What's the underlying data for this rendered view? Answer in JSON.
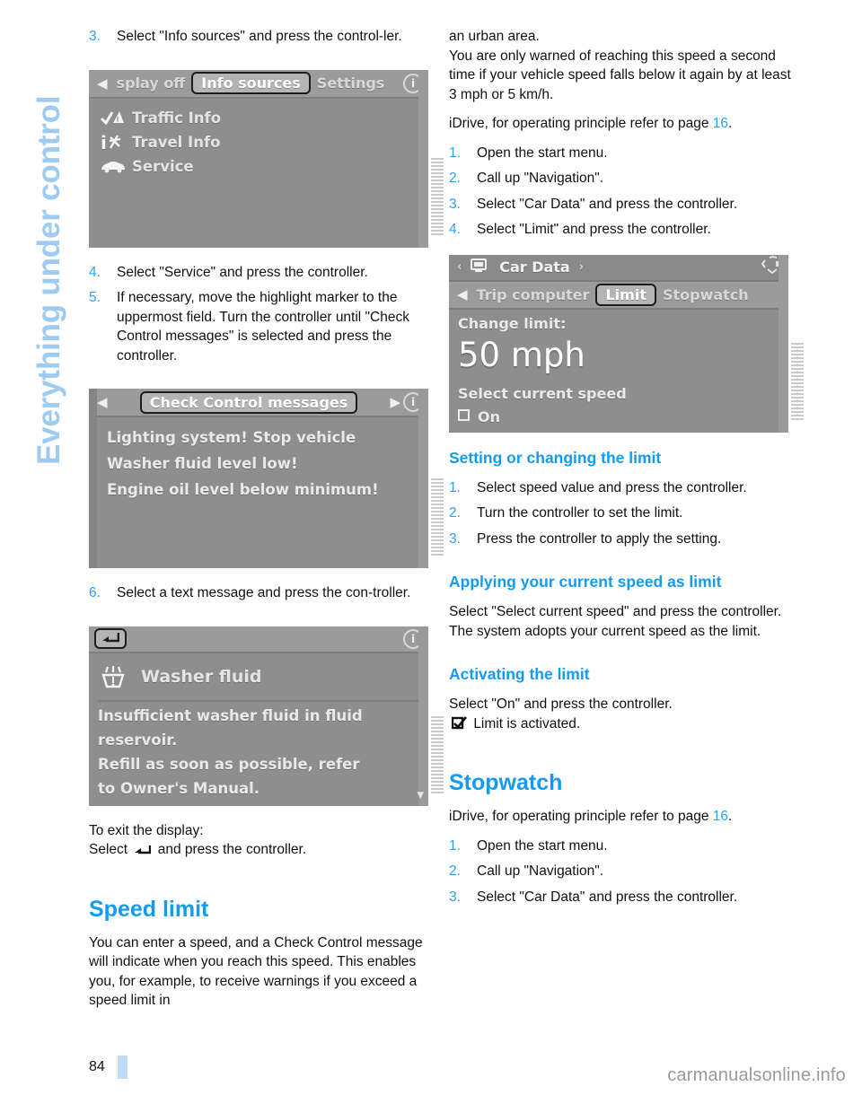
{
  "chapter": {
    "title": "Everything under control"
  },
  "footer": {
    "page_number": "84",
    "watermark": "carmanualsonline.info"
  },
  "left_column": {
    "step3": {
      "num": "3.",
      "text": "Select \"Info sources\" and press the control-ler."
    },
    "shot_info_sources": {
      "tabs": [
        {
          "label": "splay off",
          "selected": false
        },
        {
          "label": "Info sources",
          "selected": true
        },
        {
          "label": "Settings",
          "selected": false
        }
      ],
      "left_arrow": "◀",
      "info_glyph": "i",
      "items": [
        {
          "icon": "traffic-info-icon",
          "label": "Traffic Info"
        },
        {
          "icon": "travel-info-icon",
          "label": "Travel Info"
        },
        {
          "icon": "service-car-icon",
          "label": "Service"
        }
      ]
    },
    "steps_4_5": [
      {
        "num": "4.",
        "text": "Select \"Service\" and press the controller."
      },
      {
        "num": "5.",
        "text": "If necessary, move the highlight marker to the uppermost field. Turn the controller until \"Check Control messages\" is selected and press the controller."
      }
    ],
    "shot_check_control": {
      "title": "Check Control messages",
      "left_arrow": "◀",
      "right_arrow": "▶",
      "info_glyph": "i",
      "messages": [
        "Lighting system! Stop vehicle",
        "Washer fluid level low!",
        "Engine oil level below minimum!"
      ]
    },
    "step6": {
      "num": "6.",
      "text": "Select a text message and press the con-troller."
    },
    "shot_washer_fluid": {
      "back_button": "back-arrow-icon",
      "info_glyph": "i",
      "item_icon": "washer-fluid-icon",
      "item_label": "Washer fluid",
      "body_lines": [
        "Insufficient washer fluid in fluid",
        "reservoir.",
        "Refill as soon as possible, refer",
        "to Owner's Manual."
      ],
      "scroll_caret": "▾"
    },
    "exit_display": {
      "line1": "To exit the display:",
      "line2_before": "Select",
      "line2_after": "and press the controller."
    },
    "speed_limit": {
      "heading": "Speed limit",
      "paragraph": "You can enter a speed, and a Check Control message will indicate when you reach this speed. This enables you, for example, to receive warnings if you exceed a speed limit in"
    }
  },
  "right_column": {
    "continued_paragraph_1": "an urban area.",
    "continued_paragraph_2": "You are only warned of reaching this speed a second time if your vehicle speed falls below it again by at least 3 mph or 5 km/h.",
    "idrive_note": {
      "before": "iDrive, for operating principle refer to page ",
      "page": "16",
      "after": "."
    },
    "limit_steps": [
      {
        "num": "1.",
        "text": "Open the start menu."
      },
      {
        "num": "2.",
        "text": "Call up \"Navigation\"."
      },
      {
        "num": "3.",
        "text": "Select \"Car Data\" and press the controller."
      },
      {
        "num": "4.",
        "text": "Select \"Limit\" and press the controller."
      }
    ],
    "shot_car_data": {
      "header_title": "Car Data",
      "header_left_arrow": "‹",
      "header_right_arrow": "›",
      "header_icon": "display-screen-icon",
      "controller_icon": "idrive-controller-icon",
      "tabs": [
        {
          "label": "Trip computer",
          "selected": false
        },
        {
          "label": "Limit",
          "selected": true
        },
        {
          "label": "Stopwatch",
          "selected": false
        }
      ],
      "left_arrow": "◀",
      "change_limit_label": "Change limit:",
      "limit_value": "50 mph",
      "select_current_speed_label": "Select current speed",
      "on_label": "On"
    },
    "setting_changing": {
      "heading": "Setting or changing the limit",
      "steps": [
        {
          "num": "1.",
          "text": "Select speed value and press the controller."
        },
        {
          "num": "2.",
          "text": "Turn the controller to set the limit."
        },
        {
          "num": "3.",
          "text": "Press the controller to apply the setting."
        }
      ]
    },
    "applying_speed": {
      "heading": "Applying your current speed as limit",
      "paragraph": "Select \"Select current speed\" and press the controller. The system adopts your current speed as the limit."
    },
    "activating_limit": {
      "heading": "Activating the limit",
      "line1": "Select \"On\" and press the controller.",
      "line2": "Limit is activated.",
      "icon": "checkbox-checked-icon"
    },
    "stopwatch": {
      "heading": "Stopwatch",
      "idrive_note": {
        "before": "iDrive, for operating principle refer to page ",
        "page": "16",
        "after": "."
      },
      "steps": [
        {
          "num": "1.",
          "text": "Open the start menu."
        },
        {
          "num": "2.",
          "text": "Call up \"Navigation\"."
        },
        {
          "num": "3.",
          "text": "Select \"Car Data\" and press the controller."
        }
      ]
    }
  },
  "colors": {
    "accent_blue": "#129bf0",
    "step_number_blue": "#2aa3f0",
    "chapter_tab_blue": "#9ecbf2",
    "screenshot_grey": "#8e8e8e"
  }
}
